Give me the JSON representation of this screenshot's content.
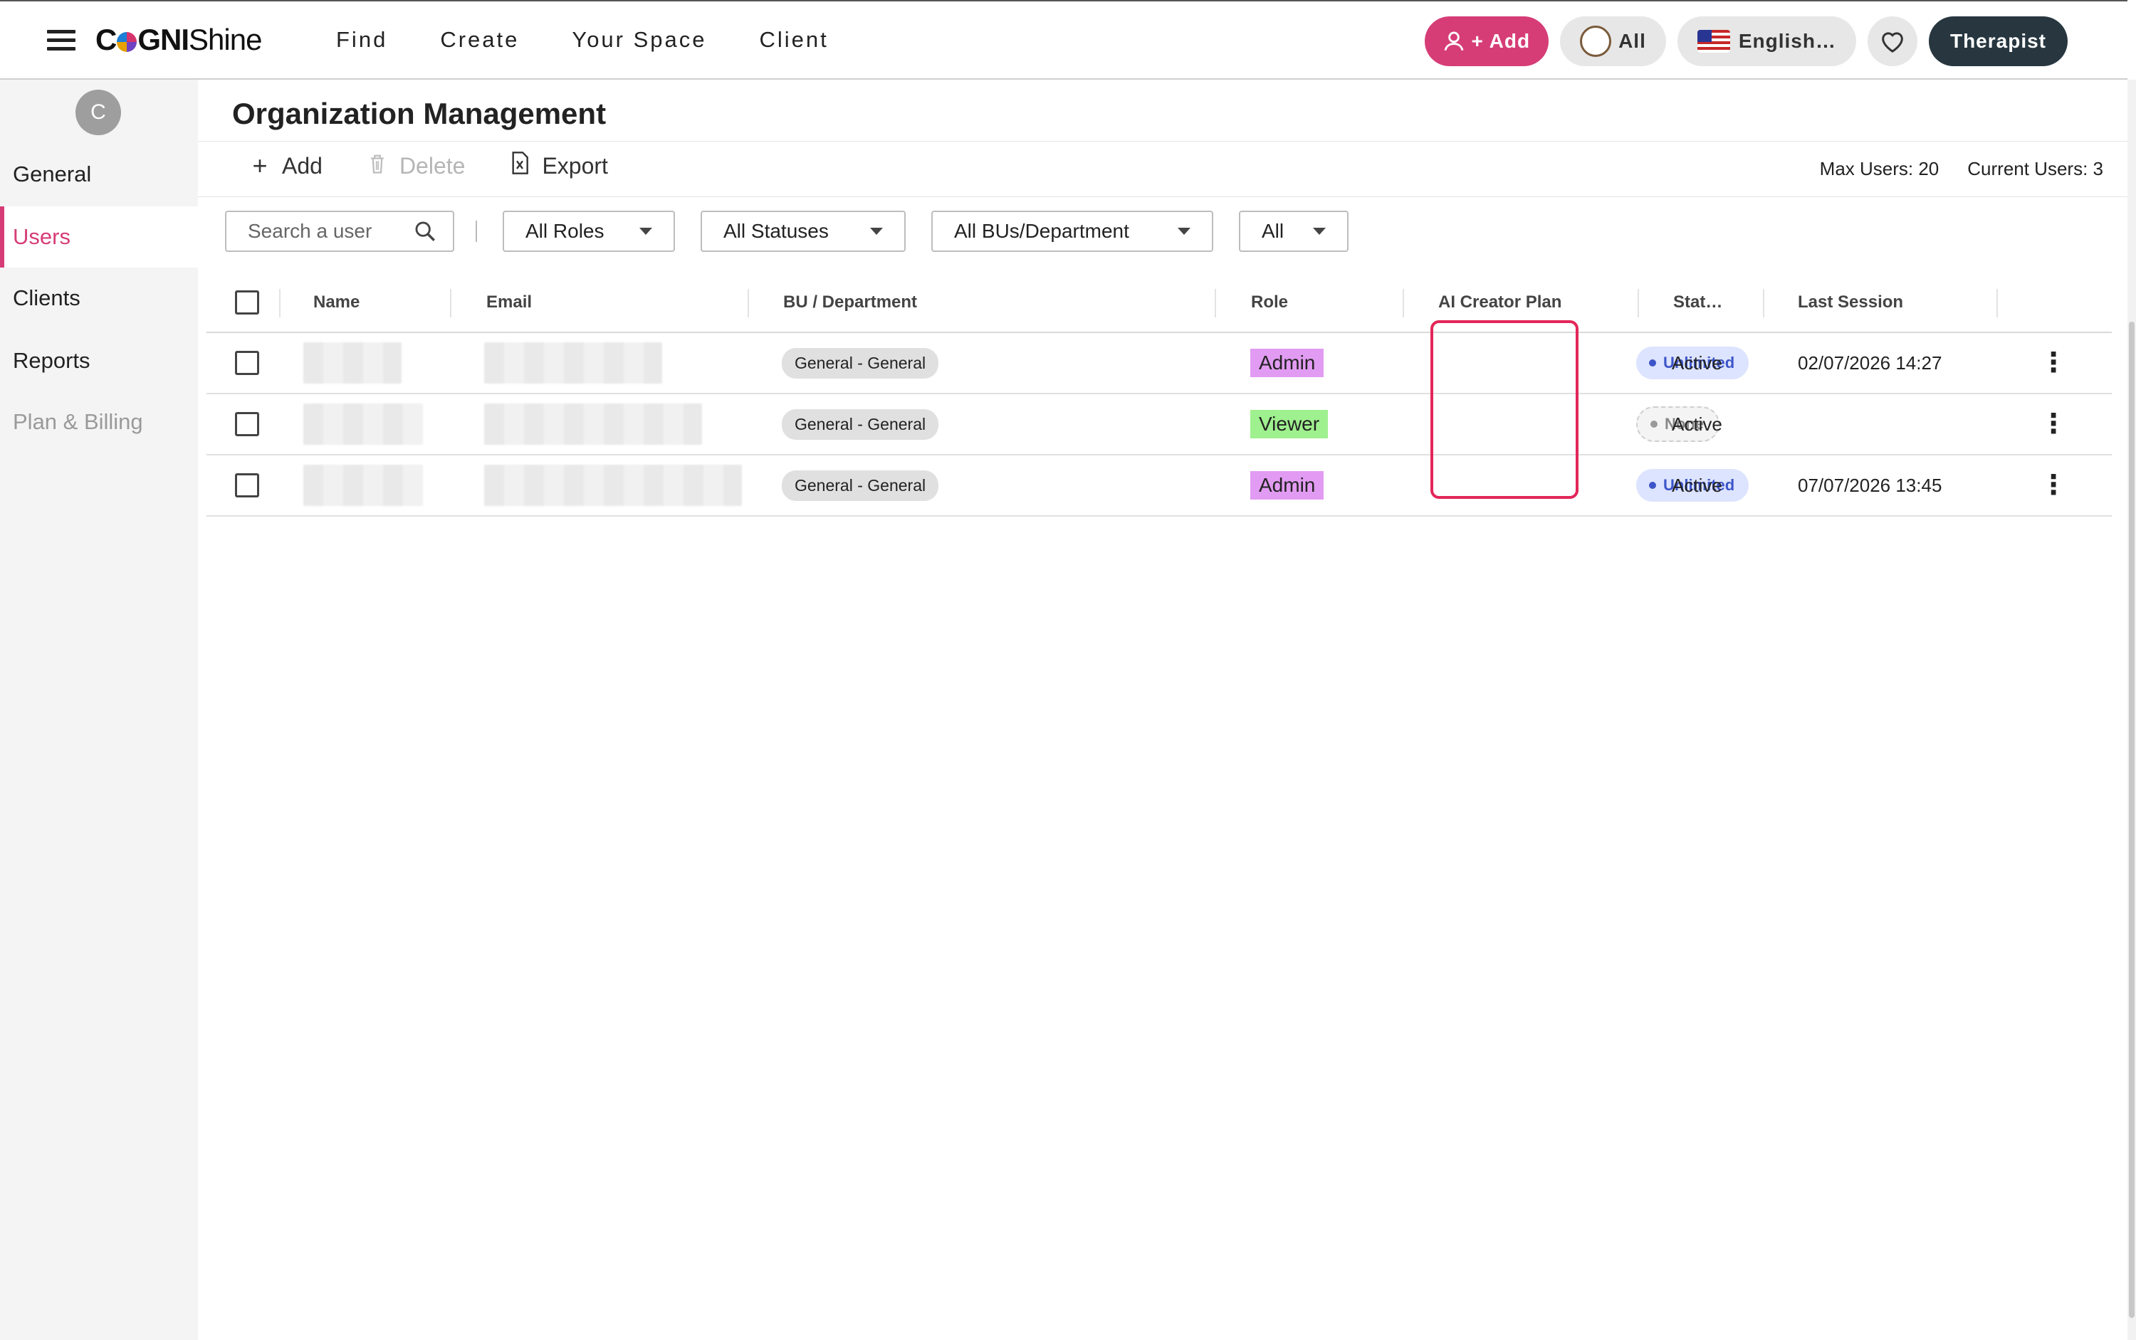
{
  "header": {
    "logo_prefix": "C",
    "logo_mid": "GNI",
    "logo_suffix": "Shine",
    "nav": [
      "Find",
      "Create",
      "Your Space",
      "Client"
    ],
    "add_label": "+ Add",
    "all_label": "All",
    "language_label": "English…",
    "role_label": "Therapist",
    "accent_color": "#d63d77"
  },
  "sidebar": {
    "avatar_initial": "C",
    "items": [
      {
        "label": "General",
        "state": "normal"
      },
      {
        "label": "Users",
        "state": "active"
      },
      {
        "label": "Clients",
        "state": "normal"
      },
      {
        "label": "Reports",
        "state": "normal"
      },
      {
        "label": "Plan & Billing",
        "state": "disabled"
      }
    ]
  },
  "main": {
    "title": "Organization Management",
    "toolbar": {
      "add": "Add",
      "delete": "Delete",
      "export": "Export"
    },
    "max_users": "Max Users: 20",
    "current_users": "Current Users: 3",
    "search_placeholder": "Search a user",
    "filters": {
      "roles": "All Roles",
      "statuses": "All Statuses",
      "department": "All BUs/Department",
      "all": "All"
    },
    "columns": [
      "Name",
      "Email",
      "BU / Department",
      "Role",
      "AI Creator Plan",
      "Stat…",
      "Last Session"
    ],
    "rows": [
      {
        "department": "General - General",
        "role": "Admin",
        "role_color": "#e29bf2",
        "plan": "Unlimited",
        "status": "Active",
        "last_session": "02/07/2026 14:27"
      },
      {
        "department": "General - General",
        "role": "Viewer",
        "role_color": "#9ff08e",
        "plan": "None",
        "status": "Active",
        "last_session": ""
      },
      {
        "department": "General - General",
        "role": "Admin",
        "role_color": "#e29bf2",
        "plan": "Unlimited",
        "status": "Active",
        "last_session": "07/07/2026 13:45"
      }
    ]
  }
}
